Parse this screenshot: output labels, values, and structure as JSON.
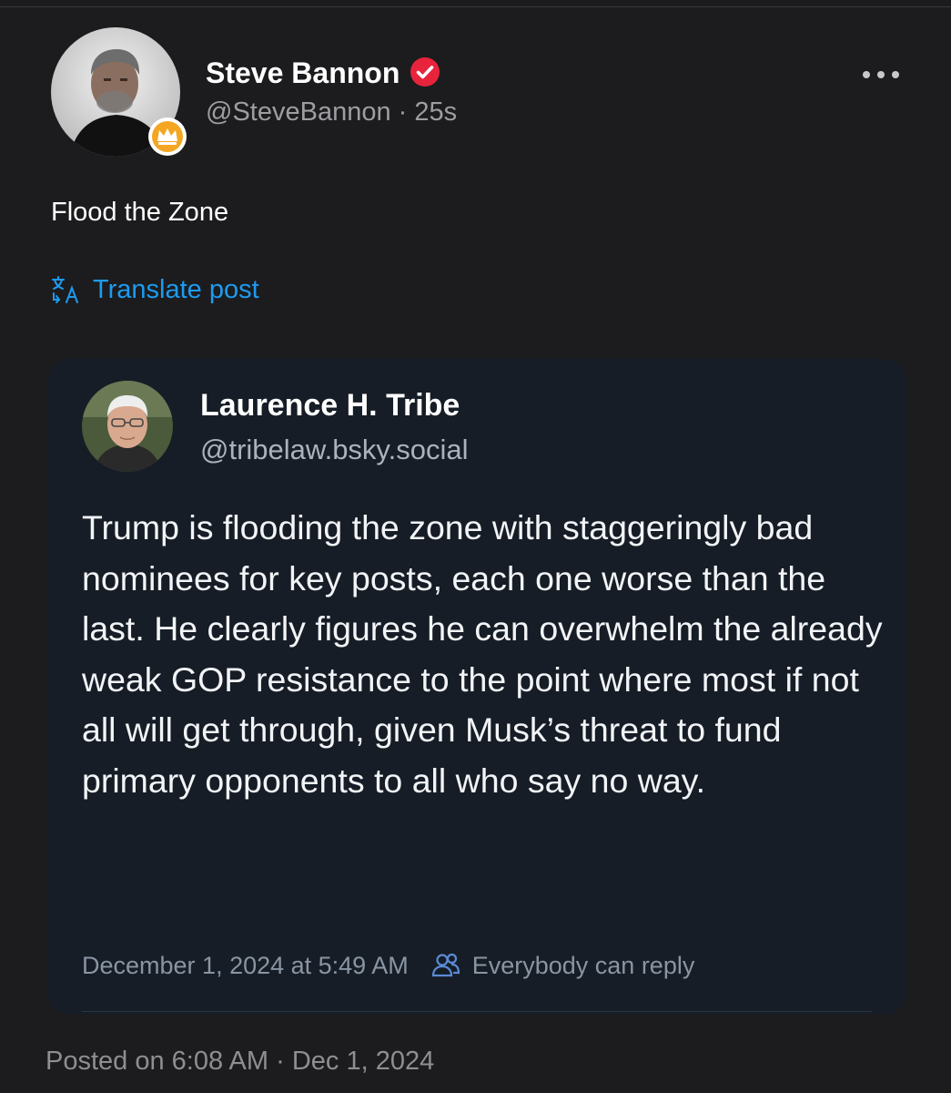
{
  "post": {
    "author_name": "Steve Bannon",
    "handle": "@SteveBannon",
    "separator": "·",
    "time_ago": "25s",
    "text": "Flood the Zone",
    "translate_label": "Translate post",
    "posted_on": "Posted on 6:08 AM · Dec 1, 2024"
  },
  "quote": {
    "author_name": "Laurence H. Tribe",
    "handle": "@tribelaw.bsky.social",
    "text": "Trump is flooding the zone with staggeringly bad nominees for key posts, each one worse than the last. He clearly figures he can overwhelm the already weak GOP resistance to the point where most if not all will get through, given Musk’s threat to fund primary opponents to all who say no way.",
    "date": "December 1, 2024 at 5:49 AM",
    "reply_setting": "Everybody can reply"
  },
  "icons": {
    "verified": "verified-check-icon",
    "crown": "crown-badge-icon",
    "more": "more-dots-icon",
    "translate": "translate-icon",
    "reply": "people-icon"
  },
  "colors": {
    "background": "#1c1c1e",
    "card": "#161d26",
    "link": "#1d9bf0",
    "verified": "#e8243c",
    "badge": "#f4a623"
  }
}
